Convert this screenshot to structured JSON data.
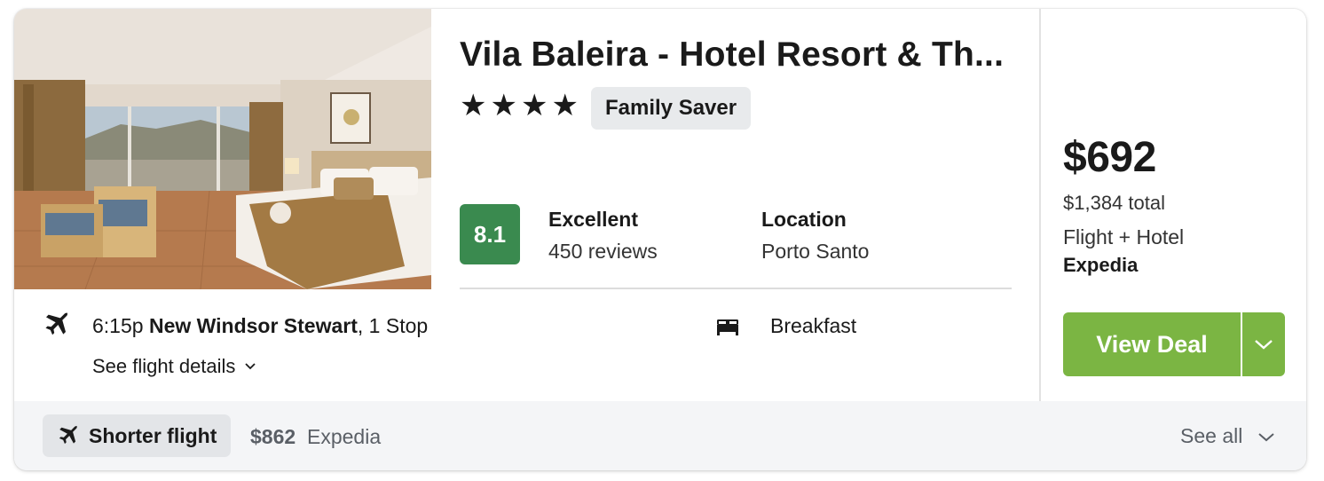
{
  "hotel": {
    "name": "Vila Baleira - Hotel Resort & Th...",
    "stars": [
      "★",
      "★",
      "★",
      "★"
    ],
    "badge": "Family Saver",
    "score": "8.1",
    "rating_label": "Excellent",
    "reviews": "450 reviews",
    "location_label": "Location",
    "location_value": "Porto Santo"
  },
  "flight": {
    "time": "6:15p",
    "airport": "New Windsor Stewart",
    "stops": ", 1 Stop",
    "details_link": "See flight details",
    "amenity": "Breakfast"
  },
  "pricing": {
    "price": "$692",
    "total": "$1,384 total",
    "package_type": "Flight + Hotel",
    "provider": "Expedia",
    "cta": "View Deal"
  },
  "footer": {
    "tag": "Shorter flight",
    "alt_price": "$862",
    "alt_provider": "Expedia",
    "see_all": "See all"
  },
  "colors": {
    "score_bg": "#3a8a4f",
    "cta_bg": "#7bb543",
    "badge_bg": "#e8eaec",
    "footer_bg": "#f4f5f7"
  },
  "icons": {
    "flight": "plane-icon",
    "amenity": "bed-icon",
    "details_chevron": "chevron-down-icon",
    "dropdown": "chevron-down-icon"
  }
}
